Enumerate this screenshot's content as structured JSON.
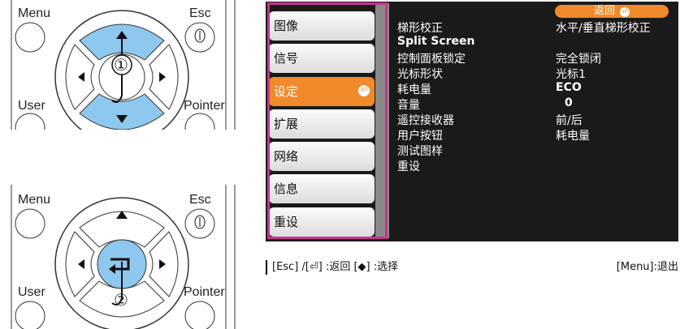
{
  "remote_top": {
    "menu": "Menu",
    "esc": "Esc",
    "user": "User",
    "pointer": "Pointer",
    "step": "①"
  },
  "remote_bottom": {
    "menu": "Menu",
    "esc": "Esc",
    "user": "User",
    "pointer": "Pointer",
    "step": "②"
  },
  "menu": {
    "items": [
      {
        "label": "图像"
      },
      {
        "label": "信号"
      },
      {
        "label": "设定",
        "active": true
      },
      {
        "label": "扩展"
      },
      {
        "label": "网络"
      },
      {
        "label": "信息"
      },
      {
        "label": "重设"
      }
    ]
  },
  "back_button": {
    "label": "返回"
  },
  "settings": [
    {
      "label": "梯形校正",
      "value": "水平/垂直梯形校正"
    },
    {
      "label": "Split Screen",
      "value": ""
    },
    {
      "label": "控制面板锁定",
      "value": "完全锁闭"
    },
    {
      "label": "光标形状",
      "value": "光标1"
    },
    {
      "label": "耗电量",
      "value": "ECO"
    },
    {
      "label": "音量",
      "value": "0"
    },
    {
      "label": "遥控接收器",
      "value": "前/后"
    },
    {
      "label": "用户按钮",
      "value": "耗电量"
    },
    {
      "label": "测试图样",
      "value": ""
    },
    {
      "label": "重设",
      "value": ""
    }
  ],
  "footer": {
    "left": "[Esc] /[⏎] :返回 [◆] :选择",
    "right": "[Menu]:退出"
  },
  "colors": {
    "accent": "#f08a2a",
    "highlight": "#c8338f",
    "screen_bg": "#1a1a1a",
    "button_blue": "#8ec8ee"
  }
}
